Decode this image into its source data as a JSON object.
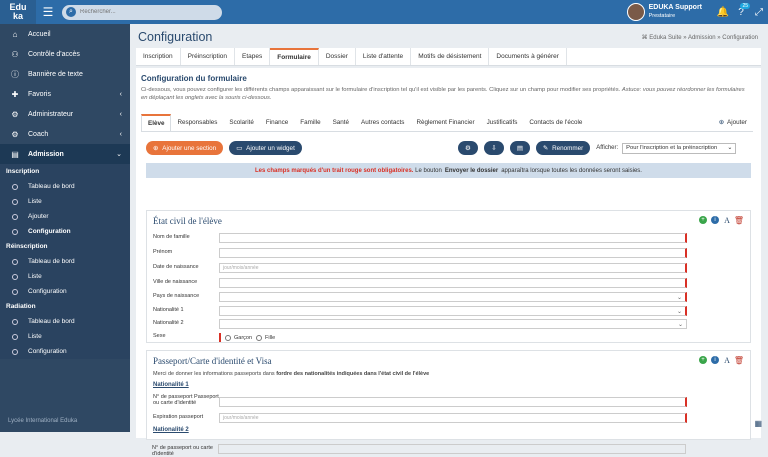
{
  "app": {
    "logo_line1": "Edu",
    "logo_line2": "ka"
  },
  "search": {
    "placeholder": "Rechercher..."
  },
  "user": {
    "name": "EDUKA Support",
    "role": "Prestataire",
    "help_badge": "25"
  },
  "sidebar": {
    "items": [
      {
        "label": "Accueil",
        "icon": "home-icon"
      },
      {
        "label": "Contrôle d'accès",
        "icon": "users-icon"
      },
      {
        "label": "Bannière de texte",
        "icon": "info-icon"
      },
      {
        "label": "Favoris",
        "icon": "pin-icon"
      },
      {
        "label": "Administrateur",
        "icon": "user-cog-icon"
      },
      {
        "label": "Coach",
        "icon": "user-cog-icon"
      },
      {
        "label": "Admission",
        "icon": "file-icon"
      }
    ],
    "sections": [
      {
        "title": "Inscription",
        "links": [
          "Tableau de bord",
          "Liste",
          "Ajouter",
          "Configuration"
        ]
      },
      {
        "title": "Réinscription",
        "links": [
          "Tableau de bord",
          "Liste",
          "Configuration"
        ]
      },
      {
        "title": "Radiation",
        "links": [
          "Tableau de bord",
          "Liste",
          "Configuration"
        ]
      }
    ],
    "footer": "Lycée International Eduka"
  },
  "page": {
    "title": "Configuration",
    "breadcrumb": "Eduka Suite » Admission » Configuration",
    "tabs": [
      "Inscription",
      "Préinscription",
      "Etapes",
      "Formulaire",
      "Dossier",
      "Liste d'attente",
      "Motifs de désistement",
      "Documents à générer"
    ],
    "active_tab": 3
  },
  "form_config": {
    "title": "Configuration du formulaire",
    "desc_line1": "Ci-dessous, vous pouvez configurer les différents champs apparaissant sur le formulaire d'inscription tel qu'il est visible par les parents. Cliquez sur un champ pour modifier ses propriétés.",
    "desc_astuce": "Astuce: vous pouvez réordonner les formulaires en déplaçant les onglets avec la souris ci-dessous.",
    "tabs": [
      "Elève",
      "Responsables",
      "Scolarité",
      "Finance",
      "Famille",
      "Santé",
      "Autres contacts",
      "Règlement Financier",
      "Justificatifs",
      "Contacts de l'école"
    ],
    "add_label": "Ajouter",
    "btn_section": "Ajouter une section",
    "btn_widget": "Ajouter un widget",
    "btn_rename": "Renommer",
    "afficher_label": "Afficher:",
    "afficher_value": "Pour l'inscription et la préinscription",
    "notice_red": "Les champs marqués d'un trait rouge sont obligatoires.",
    "notice_mid": "Le bouton",
    "notice_bold": "Envoyer le dossier",
    "notice_end": "apparaîtra lorsque toutes les données seront saisies."
  },
  "section_civil": {
    "title": "État civil de l'élève",
    "fields": [
      {
        "label": "Nom de famille",
        "placeholder": ""
      },
      {
        "label": "Prénom",
        "placeholder": ""
      },
      {
        "label": "Date de naissance",
        "placeholder": "jour/mois/année"
      },
      {
        "label": "Ville de naissance",
        "placeholder": ""
      },
      {
        "label": "Pays de naissance",
        "placeholder": ""
      },
      {
        "label": "Nationalité 1",
        "placeholder": ""
      },
      {
        "label": "Nationalité 2",
        "placeholder": ""
      }
    ],
    "sexe_label": "Sexe",
    "sexe_options": [
      "Garçon",
      "Fille"
    ]
  },
  "section_passport": {
    "title": "Passeport/Carte d'identité et Visa",
    "intro": "Merci de donner les informations passeports dans",
    "intro_bold": "fordre des nationalités indiquées dans l'état civil de l'élève",
    "nat1": "Nationalité 1",
    "nat2": "Nationalité 2",
    "f1_label": "N° de passeport Passeport ou carte d'identité",
    "f2_label": "Expiration passeport",
    "f2_placeholder": "jour/mois/année",
    "f3_label": "N° de passeport ou carte d'identité"
  },
  "colors": {
    "accent": "#e8743b",
    "navy": "#2a4a6e",
    "topbar": "#2d6ca8",
    "sidebar": "#2f4863",
    "required": "#d93025"
  }
}
